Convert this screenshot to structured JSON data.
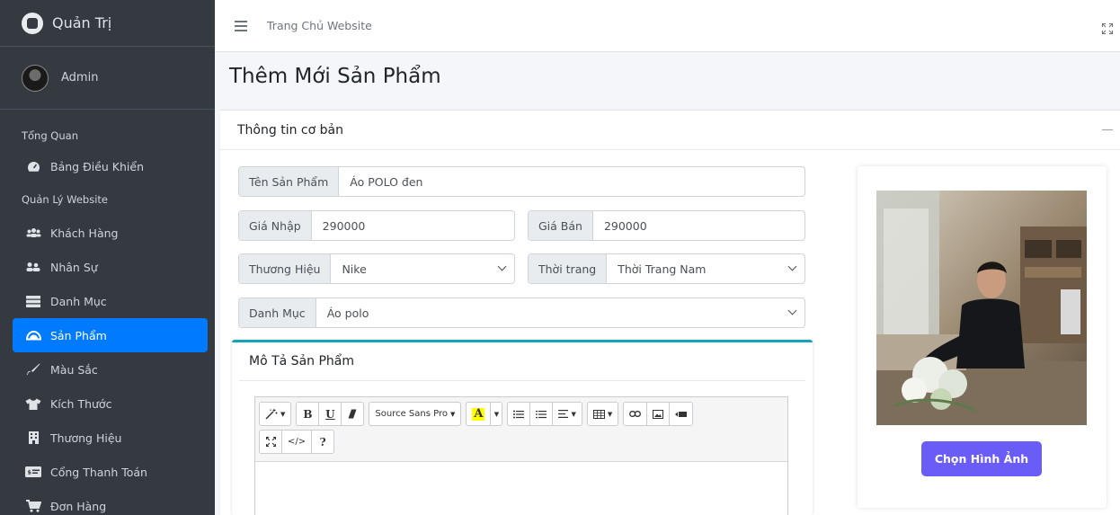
{
  "brand": {
    "name": "Quản Trị"
  },
  "user": {
    "name": "Admin"
  },
  "sidebar": {
    "headers": [
      "Tổng Quan",
      "Quản Lý Website"
    ],
    "items": [
      {
        "label": "Bảng Điều Khiển",
        "icon": "dashboard-icon"
      },
      {
        "label": "Khách Hàng",
        "icon": "users-icon"
      },
      {
        "label": "Nhân Sự",
        "icon": "staff-icon"
      },
      {
        "label": "Danh Mục",
        "icon": "list-icon"
      },
      {
        "label": "Sản Phẩm",
        "icon": "cloud-icon",
        "active": true
      },
      {
        "label": "Màu Sắc",
        "icon": "brush-icon"
      },
      {
        "label": "Kích Thước",
        "icon": "tshirt-icon"
      },
      {
        "label": "Thương Hiệu",
        "icon": "building-icon"
      },
      {
        "label": "Cổng Thanh Toán",
        "icon": "payment-icon"
      },
      {
        "label": "Đơn Hàng",
        "icon": "cart-icon"
      }
    ]
  },
  "topbar": {
    "home_link": "Trang Chủ Website"
  },
  "page": {
    "title": "Thêm Mới Sản Phẩm"
  },
  "card": {
    "title": "Thông tin cơ bản"
  },
  "form": {
    "name_label": "Tên Sản Phẩm",
    "name_value": "Áo POLO đen",
    "cost_label": "Giá Nhập",
    "cost_value": "290000",
    "price_label": "Giá Bán",
    "price_value": "290000",
    "brand_label": "Thương Hiệu",
    "brand_value": "Nike",
    "fashion_label": "Thời trang",
    "fashion_value": "Thời Trang Nam",
    "category_label": "Danh Mục",
    "category_value": "Áo polo"
  },
  "description": {
    "title": "Mô Tả Sản Phẩm",
    "font_name": "Source Sans Pro",
    "highlight_letter": "A",
    "help": "?"
  },
  "image": {
    "button_label": "Chọn Hình Ảnh"
  },
  "colors": {
    "active_nav": "#007bff",
    "sidebar_bg": "#343a40",
    "accent_button": "#6a5cf7",
    "card_top": "#17a2b8"
  }
}
